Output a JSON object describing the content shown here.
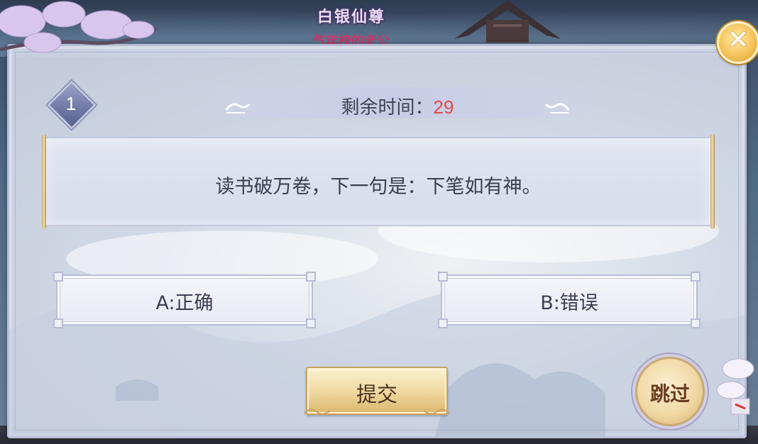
{
  "background": {
    "game_title": "白银仙尊",
    "game_subtitle": "气年榜的老公"
  },
  "quiz": {
    "question_number": "1",
    "timer_label": "剩余时间：",
    "timer_seconds": "29",
    "question": "读书破万卷，下一句是：下笔如有神。",
    "options": [
      {
        "label": "A:正确"
      },
      {
        "label": "B:错误"
      }
    ],
    "submit_label": "提交",
    "skip_label": "跳过",
    "close_icon": "close-icon"
  },
  "colors": {
    "timer_seconds": "#e04b45",
    "panel_border": "#b9bfd6",
    "submit_button": "#efd79e",
    "close_button": "#f5c35a"
  }
}
